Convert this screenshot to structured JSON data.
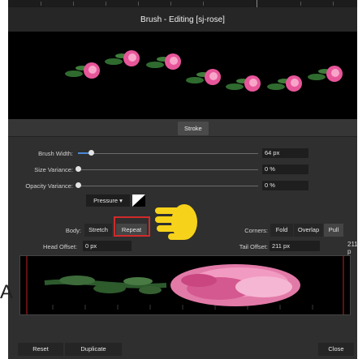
{
  "dialog": {
    "title": "Brush - Editing [sj-rose]"
  },
  "tabs": {
    "stroke_label": "Stroke"
  },
  "controls": {
    "brush_width_label": "Brush Width:",
    "brush_width_value": "64 px",
    "brush_width_level": 0.12,
    "size_variance_label": "Size Variance:",
    "size_variance_value": "0 %",
    "size_variance_level": 0.0,
    "opacity_variance_label": "Opacity Variance:",
    "opacity_variance_value": "0 %",
    "opacity_variance_level": 0.0,
    "pressure_label": "Pressure",
    "pressure_arrow": "▾"
  },
  "body": {
    "label": "Body:",
    "options": [
      "Stretch",
      "Repeat"
    ],
    "selected": "Repeat"
  },
  "corners": {
    "label": "Corners:",
    "options": [
      "Fold",
      "Overlap",
      "Pull"
    ],
    "selected": "Pull"
  },
  "offsets": {
    "head_label": "Head Offset:",
    "head_value": "0 px",
    "tail_label": "Tail Offset:",
    "tail_value": "211 px",
    "tail_value_right": "211 p"
  },
  "footer": {
    "reset_label": "Reset",
    "duplicate_label": "Duplicate",
    "close_label": "Close"
  },
  "icons": {
    "hand": "pointing-hand-icon",
    "curve": "pressure-curve-icon"
  },
  "colors": {
    "background": "#2f2f2f",
    "highlight": "#d12a2a",
    "slider_accent": "#4c88d8",
    "rose": "#e8569a",
    "hand": "#f7d21a"
  },
  "ghost_text": "A"
}
